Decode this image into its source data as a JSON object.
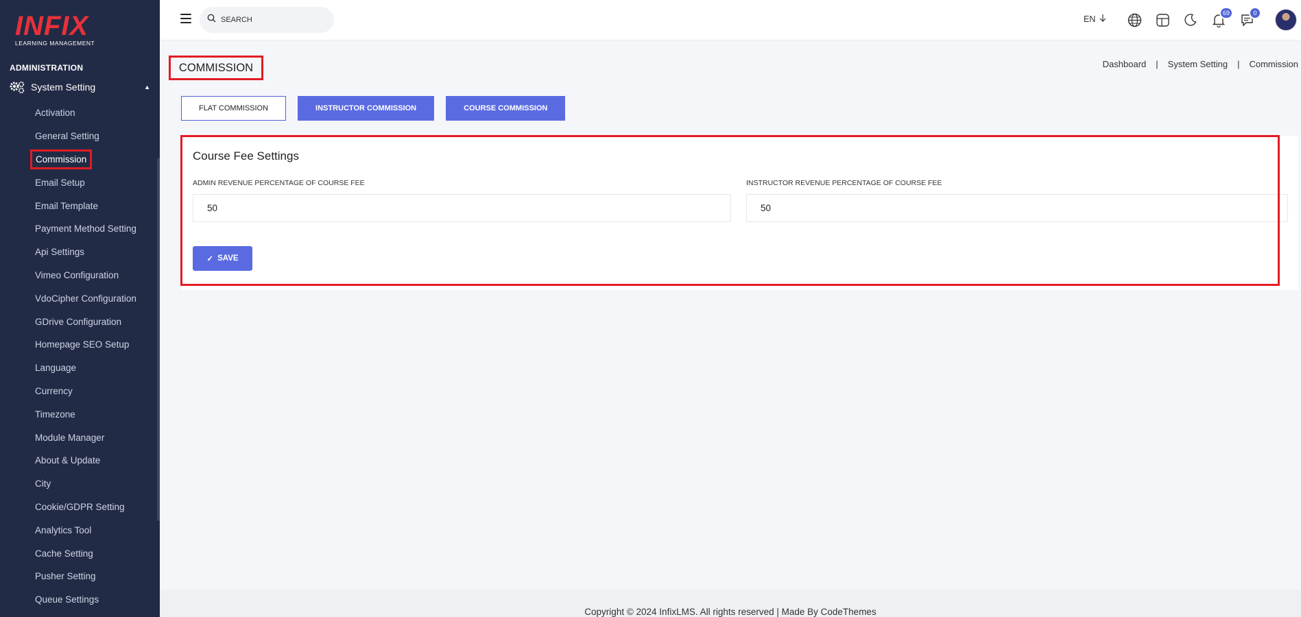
{
  "sidebar": {
    "logo_text": "INFIX",
    "logo_tagline": "LEARNING MANAGEMENT",
    "section_title": "ADMINISTRATION",
    "group_label": "System Setting",
    "items": [
      {
        "label": "Activation"
      },
      {
        "label": "General Setting"
      },
      {
        "label": "Commission"
      },
      {
        "label": "Email Setup"
      },
      {
        "label": "Email Template"
      },
      {
        "label": "Payment Method Setting"
      },
      {
        "label": "Api Settings"
      },
      {
        "label": "Vimeo Configuration"
      },
      {
        "label": "VdoCipher Configuration"
      },
      {
        "label": "GDrive Configuration"
      },
      {
        "label": "Homepage SEO Setup"
      },
      {
        "label": "Language"
      },
      {
        "label": "Currency"
      },
      {
        "label": "Timezone"
      },
      {
        "label": "Module Manager"
      },
      {
        "label": "About & Update"
      },
      {
        "label": "City"
      },
      {
        "label": "Cookie/GDPR Setting"
      },
      {
        "label": "Analytics Tool"
      },
      {
        "label": "Cache Setting"
      },
      {
        "label": "Pusher Setting"
      },
      {
        "label": "Queue Settings"
      }
    ]
  },
  "header": {
    "search_placeholder": "SEARCH",
    "language": "EN",
    "notifications_count": "69",
    "messages_count": "0"
  },
  "page": {
    "title": "COMMISSION",
    "breadcrumb": [
      "Dashboard",
      "System Setting",
      "Commission"
    ]
  },
  "tabs": [
    {
      "label": "FLAT COMMISSION"
    },
    {
      "label": "INSTRUCTOR COMMISSION"
    },
    {
      "label": "COURSE COMMISSION"
    }
  ],
  "form": {
    "heading": "Course Fee Settings",
    "admin_label": "ADMIN REVENUE PERCENTAGE OF COURSE FEE",
    "admin_value": "50",
    "instructor_label": "INSTRUCTOR REVENUE PERCENTAGE OF COURSE FEE",
    "instructor_value": "50",
    "save_label": "SAVE"
  },
  "footer": {
    "copyright": "Copyright © 2024 InfixLMS. All rights reserved | Made By CodeThemes"
  },
  "colors": {
    "sidebar_bg": "#222b45",
    "accent": "#5a6be2",
    "highlight": "#e31b23",
    "logo": "#e8313b"
  }
}
